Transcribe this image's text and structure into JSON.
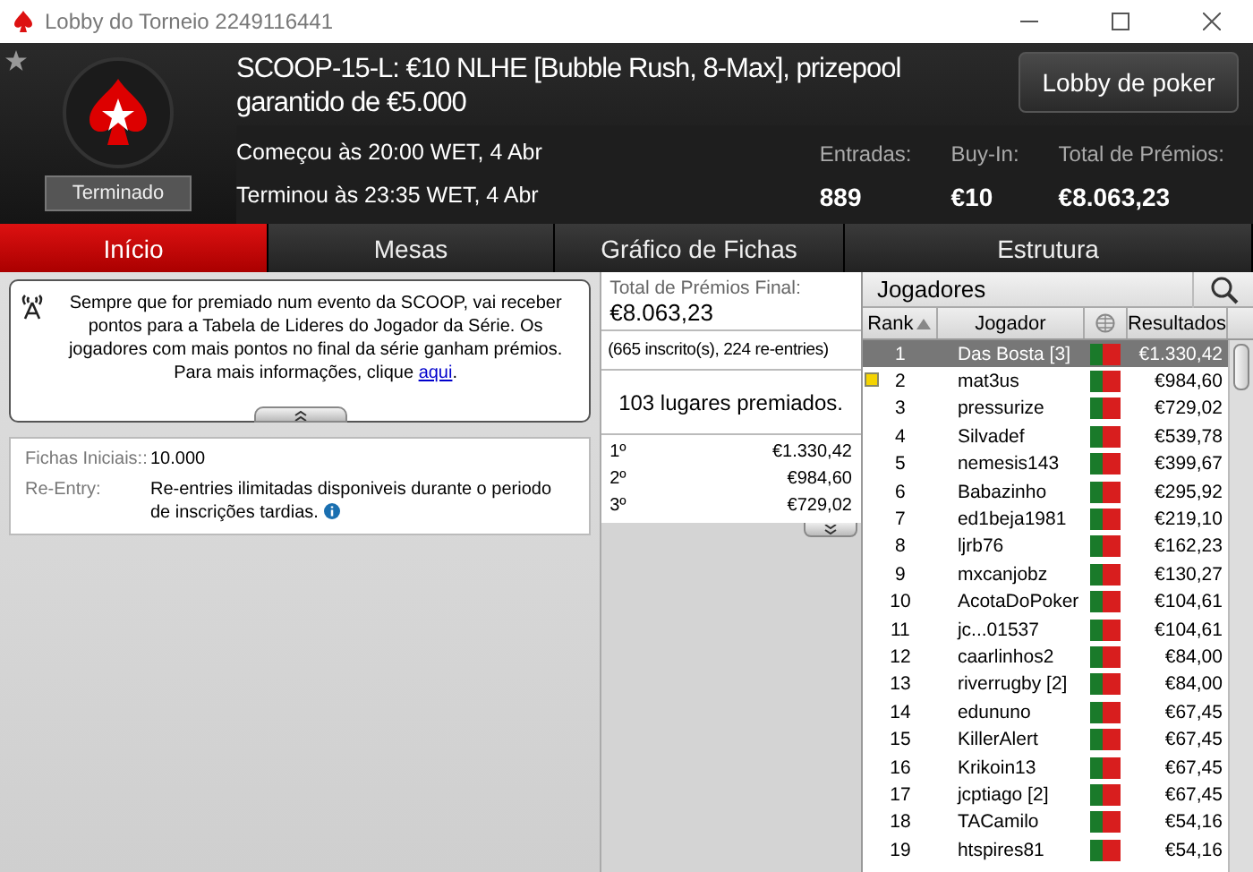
{
  "window": {
    "title": "Lobby do Torneio 2249116441"
  },
  "header": {
    "title": "SCOOP-15-L: €10 NLHE [Bubble Rush, 8-Max], prizepool garantido de €5.000",
    "status": "Terminado",
    "started": "Começou às 20:00 WET, 4 Abr",
    "ended": "Terminou às 23:35 WET, 4 Abr",
    "lobby_button": "Lobby de poker",
    "stats": [
      {
        "label": "Entradas:",
        "value": "889"
      },
      {
        "label": "Buy-In:",
        "value": "€10"
      },
      {
        "label": "Total de Prémios:",
        "value": "€8.063,23"
      }
    ]
  },
  "tabs": [
    {
      "label": "Início",
      "selected": true
    },
    {
      "label": "Mesas",
      "selected": false
    },
    {
      "label": "Gráfico de Fichas",
      "selected": false
    },
    {
      "label": "Estrutura",
      "selected": false
    }
  ],
  "notice": {
    "text": "Sempre que for premiado num evento da SCOOP, vai receber pontos para a Tabela de Lideres do Jogador da Série. Os jogadores com mais pontos no final da série ganham prémios. Para mais informações, clique",
    "link": "aqui",
    "end": "."
  },
  "details": [
    {
      "label": "Fichas Iniciais::",
      "value": "10.000"
    },
    {
      "label": "Re-Entry:",
      "value": "Re-entries ilimitadas disponiveis durante o periodo de inscrições tardias."
    }
  ],
  "prizes": {
    "label": "Total de Prémios Final:",
    "total": "€8.063,23",
    "entries": "(665 inscrito(s), 224 re-entries)",
    "places": "103 lugares premiados.",
    "rows": [
      {
        "place": "1º",
        "amount": "€1.330,42"
      },
      {
        "place": "2º",
        "amount": "€984,60"
      },
      {
        "place": "3º",
        "amount": "€729,02"
      }
    ]
  },
  "players": {
    "title": "Jogadores",
    "columns": [
      "Rank",
      "Jogador",
      "Resultados"
    ],
    "rows": [
      {
        "rank": "1",
        "name": "Das Bosta [3]",
        "result": "€1.330,42",
        "selected": true,
        "marked": false
      },
      {
        "rank": "2",
        "name": "mat3us",
        "result": "€984,60",
        "selected": false,
        "marked": true
      },
      {
        "rank": "3",
        "name": "pressurize",
        "result": "€729,02",
        "selected": false,
        "marked": false
      },
      {
        "rank": "4",
        "name": "Silvadef",
        "result": "€539,78",
        "selected": false,
        "marked": false
      },
      {
        "rank": "5",
        "name": "nemesis143",
        "result": "€399,67",
        "selected": false,
        "marked": false
      },
      {
        "rank": "6",
        "name": "Babazinho",
        "result": "€295,92",
        "selected": false,
        "marked": false
      },
      {
        "rank": "7",
        "name": "ed1beja1981",
        "result": "€219,10",
        "selected": false,
        "marked": false
      },
      {
        "rank": "8",
        "name": "ljrb76",
        "result": "€162,23",
        "selected": false,
        "marked": false
      },
      {
        "rank": "9",
        "name": "mxcanjobz",
        "result": "€130,27",
        "selected": false,
        "marked": false
      },
      {
        "rank": "10",
        "name": "AcotaDoPoker",
        "result": "€104,61",
        "selected": false,
        "marked": false
      },
      {
        "rank": "11",
        "name": "jc...01537",
        "result": "€104,61",
        "selected": false,
        "marked": false
      },
      {
        "rank": "12",
        "name": "caarlinhos2",
        "result": "€84,00",
        "selected": false,
        "marked": false
      },
      {
        "rank": "13",
        "name": "riverrugby [2]",
        "result": "€84,00",
        "selected": false,
        "marked": false
      },
      {
        "rank": "14",
        "name": "edununo",
        "result": "€67,45",
        "selected": false,
        "marked": false
      },
      {
        "rank": "15",
        "name": "KillerAlert",
        "result": "€67,45",
        "selected": false,
        "marked": false
      },
      {
        "rank": "16",
        "name": "Krikoin13",
        "result": "€67,45",
        "selected": false,
        "marked": false
      },
      {
        "rank": "17",
        "name": "jcptiago [2]",
        "result": "€67,45",
        "selected": false,
        "marked": false
      },
      {
        "rank": "18",
        "name": "TACamilo",
        "result": "€54,16",
        "selected": false,
        "marked": false
      },
      {
        "rank": "19",
        "name": "htspires81",
        "result": "€54,16",
        "selected": false,
        "marked": false
      }
    ]
  }
}
